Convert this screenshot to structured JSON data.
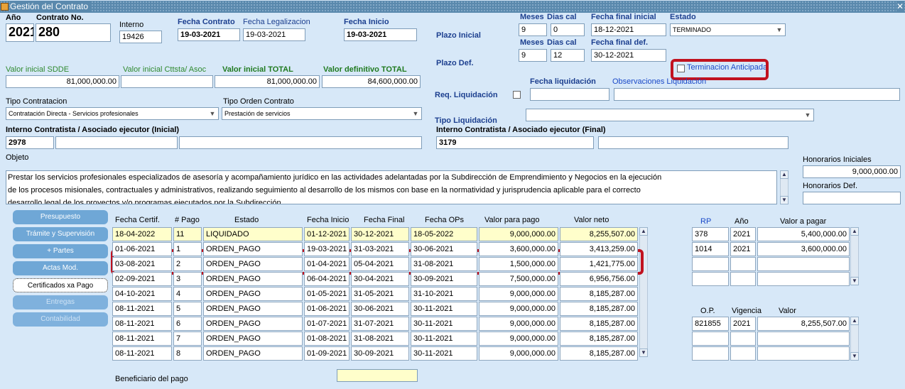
{
  "caption": "Pago No. 2 Contrato 280 Terminado y Liquidado Sistema SCO",
  "window": {
    "title": "Gestión del Contrato"
  },
  "header": {
    "ano_label": "Año",
    "ano": "2021",
    "contrato_label": "Contrato No.",
    "contrato": "280",
    "interno_label": "Interno",
    "interno": "19426",
    "fecha_contrato_label": "Fecha Contrato",
    "fecha_contrato": "19-03-2021",
    "fecha_legalizacion_label": "Fecha Legalizacion",
    "fecha_legalizacion": "19-03-2021",
    "fecha_inicio_label": "Fecha Inicio",
    "fecha_inicio": "19-03-2021"
  },
  "plazo": {
    "inicial_label": "Plazo Inicial",
    "def_label": "Plazo Def.",
    "meses_label": "Meses",
    "dias_label": "Dias cal",
    "ffi_label": "Fecha final inicial",
    "ffd_label": "Fecha final def.",
    "estado_label": "Estado",
    "ini_meses": "9",
    "ini_dias": "0",
    "ini_fecha": "18-12-2021",
    "estado": "TERMINADO",
    "def_meses": "9",
    "def_dias": "12",
    "def_fecha": "30-12-2021",
    "terminacion_label": "Terminacion Anticipada",
    "fecha_liq_label": "Fecha liquidación",
    "obs_liq_label": "Observaciones Liquidación",
    "req_liq_label": "Req. Liquidación",
    "tipo_liq_label": "Tipo Liquidación"
  },
  "valores": {
    "inicial_sdde_label": "Valor inicial SDDE",
    "inicial_sdde": "81,000,000.00",
    "inicial_cttsta_label": "Valor inicial Cttsta/ Asoc",
    "inicial_total_label": "Valor inicial TOTAL",
    "inicial_total": "81,000,000.00",
    "def_total_label": "Valor definitivo TOTAL",
    "def_total": "84,600,000.00"
  },
  "tipos": {
    "contratacion_label": "Tipo Contratacion",
    "contratacion": "Contratación Directa -  Servicios profesionales",
    "orden_label": "Tipo Orden Contrato",
    "orden": "Prestación de servicios"
  },
  "contratista": {
    "inicial_label": "Interno Contratista / Asociado ejecutor (Inicial)",
    "inicial": "2978",
    "final_label": "Interno Contratista / Asociado ejecutor (Final)",
    "final": "3179"
  },
  "objeto": {
    "label": "Objeto",
    "line1": "Prestar los servicios profesionales especializados de asesoría y acompañamiento jurídico en las actividades adelantadas por la Subdirección de Emprendimiento y Negocios en la ejecución",
    "line2": "de los procesos misionales, contractuales y administrativos, realizando seguimiento al desarrollo de los mismos con base en la normatividad y jurisprudencia aplicable para el correcto",
    "line3": "desarrollo legal de los proyectos y/o programas ejecutados por la Subdirección."
  },
  "honorarios": {
    "iniciales_label": "Honorarios Iniciales",
    "iniciales": "9,000,000.00",
    "def_label": "Honorarios Def."
  },
  "sidebar": [
    "Presupuesto",
    "Trámite y Supervisión",
    "+ Partes",
    "Actas Mod.",
    "Certificados xa Pago",
    "Entregas",
    "Contabilidad"
  ],
  "pagos": {
    "headers": [
      "Fecha Certif.",
      "# Pago",
      "Estado",
      "Fecha Inicio",
      "Fecha Final",
      "Fecha OPs",
      "Valor para pago",
      "Valor neto"
    ],
    "rows": [
      [
        "18-04-2022",
        "11",
        "LIQUIDADO",
        "01-12-2021",
        "30-12-2021",
        "18-05-2022",
        "9,000,000.00",
        "8,255,507.00"
      ],
      [
        "01-06-2021",
        "1",
        "ORDEN_PAGO",
        "19-03-2021",
        "31-03-2021",
        "30-06-2021",
        "3,600,000.00",
        "3,413,259.00"
      ],
      [
        "03-08-2021",
        "2",
        "ORDEN_PAGO",
        "01-04-2021",
        "05-04-2021",
        "31-08-2021",
        "1,500,000.00",
        "1,421,775.00"
      ],
      [
        "02-09-2021",
        "3",
        "ORDEN_PAGO",
        "06-04-2021",
        "30-04-2021",
        "30-09-2021",
        "7,500,000.00",
        "6,956,756.00"
      ],
      [
        "04-10-2021",
        "4",
        "ORDEN_PAGO",
        "01-05-2021",
        "31-05-2021",
        "31-10-2021",
        "9,000,000.00",
        "8,185,287.00"
      ],
      [
        "08-11-2021",
        "5",
        "ORDEN_PAGO",
        "01-06-2021",
        "30-06-2021",
        "30-11-2021",
        "9,000,000.00",
        "8,185,287.00"
      ],
      [
        "08-11-2021",
        "6",
        "ORDEN_PAGO",
        "01-07-2021",
        "31-07-2021",
        "30-11-2021",
        "9,000,000.00",
        "8,185,287.00"
      ],
      [
        "08-11-2021",
        "7",
        "ORDEN_PAGO",
        "01-08-2021",
        "31-08-2021",
        "30-11-2021",
        "9,000,000.00",
        "8,185,287.00"
      ],
      [
        "08-11-2021",
        "8",
        "ORDEN_PAGO",
        "01-09-2021",
        "30-09-2021",
        "30-11-2021",
        "9,000,000.00",
        "8,185,287.00"
      ]
    ],
    "beneficiario_label": "Beneficiario del pago"
  },
  "rp": {
    "headers": [
      "RP",
      "Año",
      "Valor a pagar"
    ],
    "rows": [
      [
        "378",
        "2021",
        "5,400,000.00"
      ],
      [
        "1014",
        "2021",
        "3,600,000.00"
      ],
      [
        "",
        "",
        ""
      ],
      [
        "",
        "",
        ""
      ]
    ]
  },
  "op": {
    "headers": [
      "O.P.",
      "Vigencia",
      "Valor"
    ],
    "rows": [
      [
        "821855",
        "2021",
        "8,255,507.00"
      ],
      [
        "",
        "",
        ""
      ],
      [
        "",
        "",
        ""
      ]
    ]
  }
}
